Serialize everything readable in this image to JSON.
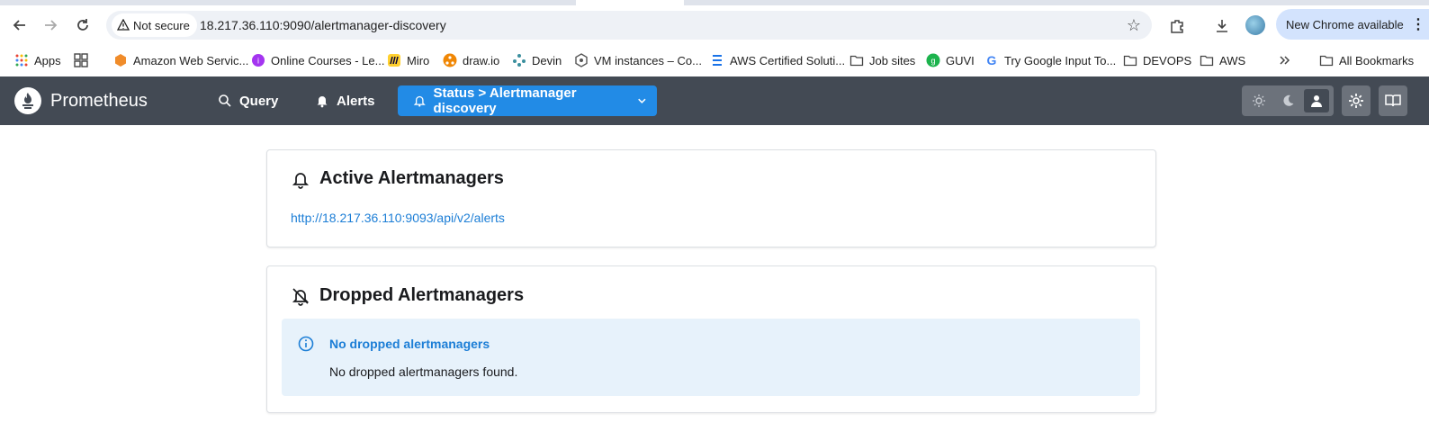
{
  "browser": {
    "security_label": "Not secure",
    "url": "18.217.36.110:9090/alertmanager-discovery",
    "new_chrome_label": "New Chrome available",
    "bookmarks": [
      {
        "label": "Apps",
        "icon": "apps-grid-icon"
      },
      {
        "label": "",
        "icon": "tab-groups-icon"
      },
      {
        "label": "Amazon Web Servic...",
        "icon": "aws-cube-icon"
      },
      {
        "label": "Online Courses - Le...",
        "icon": "udemy-icon"
      },
      {
        "label": "Miro",
        "icon": "miro-icon"
      },
      {
        "label": "draw.io",
        "icon": "drawio-icon"
      },
      {
        "label": "Devin",
        "icon": "devin-icon"
      },
      {
        "label": "VM instances – Co...",
        "icon": "gcp-icon"
      },
      {
        "label": "AWS Certified Soluti...",
        "icon": "doc-icon"
      },
      {
        "label": "Job sites",
        "icon": "folder-icon"
      },
      {
        "label": "GUVI",
        "icon": "guvi-icon"
      },
      {
        "label": "Try Google Input To...",
        "icon": "google-icon"
      },
      {
        "label": "DEVOPS",
        "icon": "folder-icon"
      },
      {
        "label": "AWS",
        "icon": "folder-icon"
      },
      {
        "label": "All Bookmarks",
        "icon": "folder-icon"
      }
    ]
  },
  "app": {
    "brand": "Prometheus",
    "nav": {
      "query": "Query",
      "alerts": "Alerts",
      "status": "Status > Alertmanager discovery"
    }
  },
  "main": {
    "active_title": "Active Alertmanagers",
    "active_link": "http://18.217.36.110:9093/api/v2/alerts",
    "dropped_title": "Dropped Alertmanagers",
    "notice_title": "No dropped alertmanagers",
    "notice_body": "No dropped alertmanagers found."
  },
  "colors": {
    "navbar": "#434a54",
    "accent": "#228be6",
    "link": "#1c7ed6",
    "notice_bg": "#e7f2fb"
  }
}
